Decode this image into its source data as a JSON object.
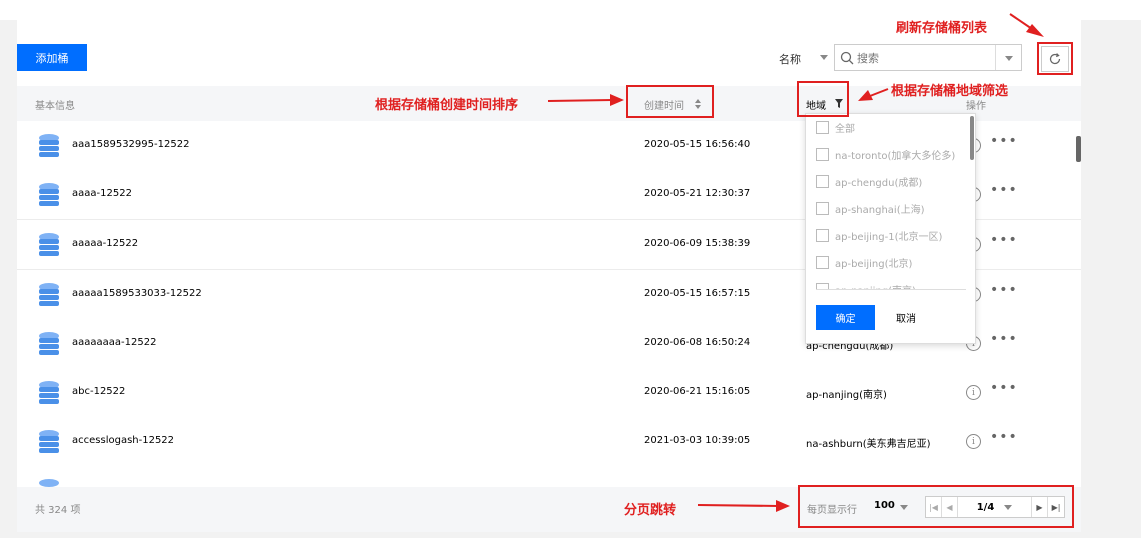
{
  "toolbar": {
    "add_bucket_label": "添加桶",
    "name_filter_label": "名称",
    "search_placeholder": "搜索"
  },
  "annotations": {
    "refresh": "刷新存储桶列表",
    "sort_by_time": "根据存储桶创建时间排序",
    "filter_by_region": "根据存储桶地域筛选",
    "pagination": "分页跳转"
  },
  "table": {
    "headers": {
      "basic_info": "基本信息",
      "created_time": "创建时间",
      "region": "地域",
      "operation": "操作"
    },
    "rows": [
      {
        "name": "aaa1589532995-12522",
        "time": "2020-05-15 16:56:40",
        "region": ""
      },
      {
        "name": "aaaa-12522",
        "time": "2020-05-21 12:30:37",
        "region": ""
      },
      {
        "name": "aaaaa-12522",
        "time": "2020-06-09 15:38:39",
        "region": ""
      },
      {
        "name": "aaaaa1589533033-12522",
        "time": "2020-05-15 16:57:15",
        "region": ""
      },
      {
        "name": "aaaaaaaa-12522",
        "time": "2020-06-08 16:50:24",
        "region": "ap-chengdu(成都)"
      },
      {
        "name": "abc-12522",
        "time": "2020-06-21 15:16:05",
        "region": "ap-nanjing(南京)"
      },
      {
        "name": "accesslogash-12522",
        "time": "2021-03-03 10:39:05",
        "region": "na-ashburn(美东弗吉尼亚)"
      }
    ]
  },
  "region_filter": {
    "options": [
      "全部",
      "na-toronto(加拿大多伦多)",
      "ap-chengdu(成都)",
      "ap-shanghai(上海)",
      "ap-beijing-1(北京一区)",
      "ap-beijing(北京)",
      "ap-nanjing(南京)"
    ],
    "confirm_label": "确定",
    "cancel_label": "取消"
  },
  "footer": {
    "total": "共 324 项",
    "per_page_label": "每页显示行",
    "per_page_value": "100",
    "page_indicator": "1/4"
  },
  "colors": {
    "primary": "#006eff",
    "annotation": "#e02020",
    "bucket_icon": "#4a90e8"
  }
}
